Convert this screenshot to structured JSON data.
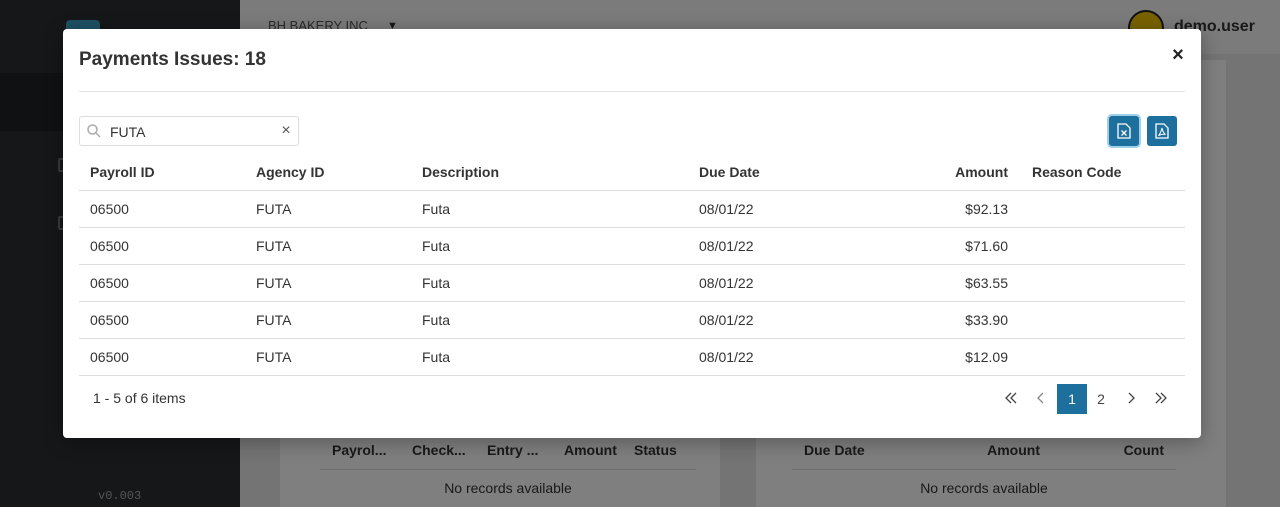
{
  "sidebar": {
    "version": "v0.003"
  },
  "topbar": {
    "company": "BH BAKERY INC",
    "username": "demo.user"
  },
  "background_tables": {
    "left": {
      "headers": [
        "Payrol...",
        "Check...",
        "Entry ...",
        "Amount",
        "Status"
      ],
      "empty": "No records available"
    },
    "right": {
      "headers": [
        "Due Date",
        "Amount",
        "Count"
      ],
      "empty": "No records available"
    }
  },
  "modal": {
    "title": "Payments Issues: 18",
    "close_label": "×",
    "search": {
      "value": "FUTA",
      "placeholder": "",
      "clear_label": "×"
    },
    "table": {
      "headers": {
        "payroll_id": "Payroll ID",
        "agency_id": "Agency ID",
        "description": "Description",
        "due_date": "Due Date",
        "amount": "Amount",
        "reason_code": "Reason Code"
      },
      "rows": [
        {
          "payroll_id": "06500",
          "agency_id": "FUTA",
          "description": "Futa",
          "due_date": "08/01/22",
          "amount": "$92.13",
          "reason_code": ""
        },
        {
          "payroll_id": "06500",
          "agency_id": "FUTA",
          "description": "Futa",
          "due_date": "08/01/22",
          "amount": "$71.60",
          "reason_code": ""
        },
        {
          "payroll_id": "06500",
          "agency_id": "FUTA",
          "description": "Futa",
          "due_date": "08/01/22",
          "amount": "$63.55",
          "reason_code": ""
        },
        {
          "payroll_id": "06500",
          "agency_id": "FUTA",
          "description": "Futa",
          "due_date": "08/01/22",
          "amount": "$33.90",
          "reason_code": ""
        },
        {
          "payroll_id": "06500",
          "agency_id": "FUTA",
          "description": "Futa",
          "due_date": "08/01/22",
          "amount": "$12.09",
          "reason_code": ""
        }
      ]
    },
    "pager": {
      "info": "1 - 5 of 6 items",
      "pages": [
        "1",
        "2"
      ],
      "current_page": "1"
    },
    "colors": {
      "accent": "#1d6f9e"
    }
  }
}
